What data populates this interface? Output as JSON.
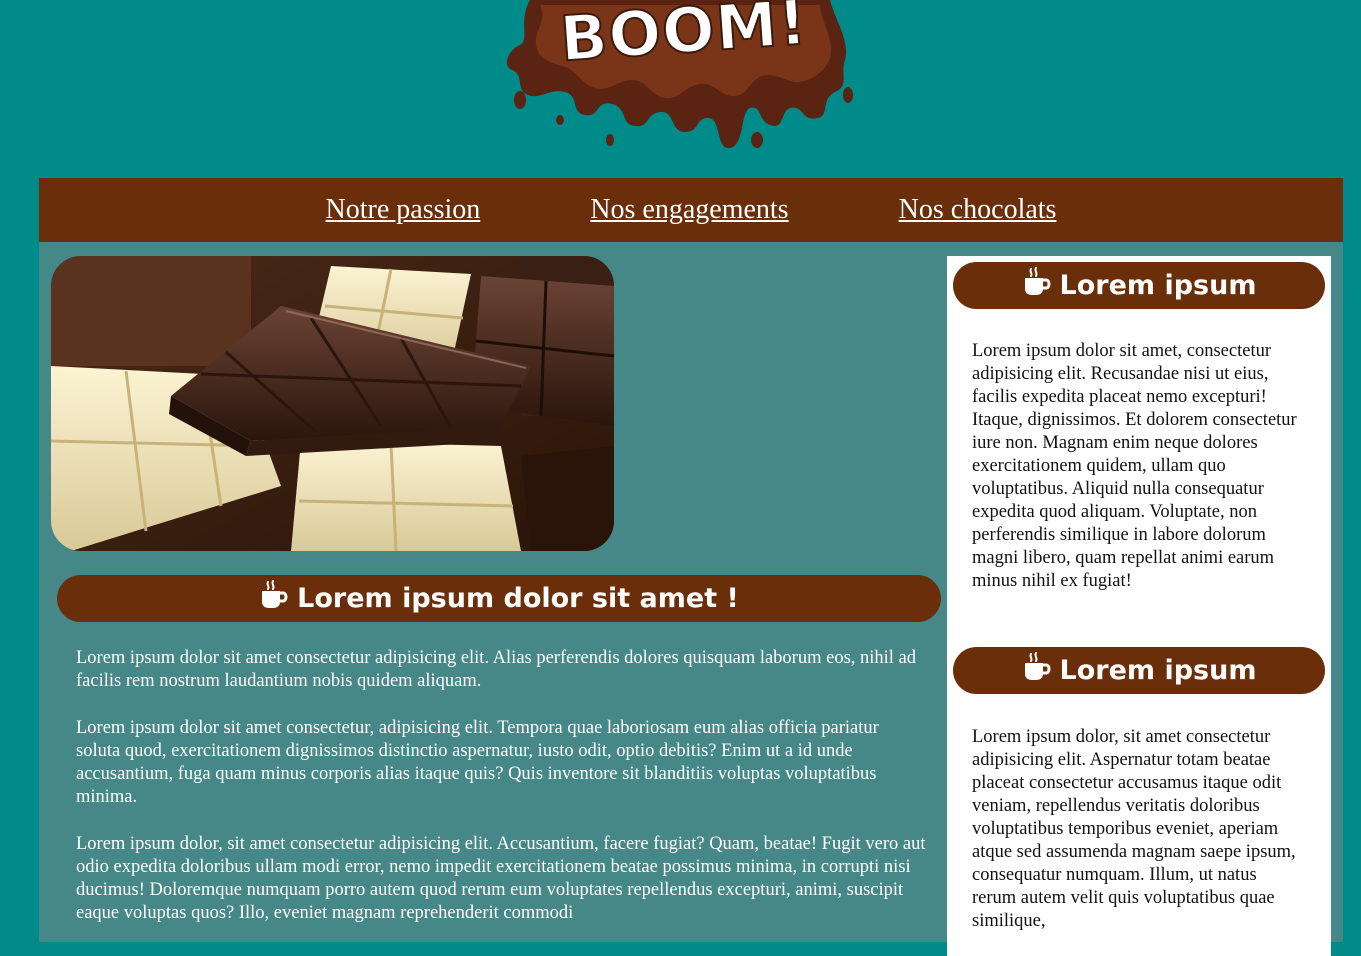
{
  "logo": {
    "text": "BOOM!"
  },
  "nav": {
    "items": [
      {
        "label": "Notre passion"
      },
      {
        "label": "Nos engagements"
      },
      {
        "label": "Nos chocolats"
      }
    ]
  },
  "main": {
    "title": "Lorem ipsum dolor sit amet !",
    "paragraphs": [
      "Lorem ipsum dolor sit amet consectetur adipisicing elit. Alias perferendis dolores quisquam laborum eos, nihil ad facilis rem nostrum laudantium nobis quidem aliquam.",
      "Lorem ipsum dolor sit amet consectetur, adipisicing elit. Tempora quae laboriosam eum alias officia pariatur soluta quod, exercitationem dignissimos distinctio aspernatur, iusto odit, optio debitis? Enim ut a id unde accusantium, fuga quam minus corporis alias itaque quis? Quis inventore sit blanditiis voluptas voluptatibus minima.",
      "Lorem ipsum dolor, sit amet consectetur adipisicing elit. Accusantium, facere fugiat? Quam, beatae! Fugit vero aut odio expedita doloribus ullam modi error, nemo impedit exercitationem beatae possimus minima, in corrupti nisi ducimus! Doloremque numquam porro autem quod rerum eum voluptates repellendus excepturi, animi, suscipit eaque voluptas quos? Illo, eveniet magnam reprehenderit commodi"
    ]
  },
  "aside": {
    "sections": [
      {
        "title": "Lorem ipsum",
        "text": "Lorem ipsum dolor sit amet, consectetur adipisicing elit. Recusandae nisi ut eius, facilis expedita placeat nemo excepturi! Itaque, dignissimos. Et dolorem consectetur iure non. Magnam enim neque dolores exercitationem quidem, ullam quo voluptatibus. Aliquid nulla consequatur expedita quod aliquam. Voluptate, non perferendis similique in labore dolorum magni libero, quam repellat animi earum minus nihil ex fugiat!"
      },
      {
        "title": "Lorem ipsum",
        "text": "Lorem ipsum dolor, sit amet consectetur adipisicing elit. Aspernatur totam beatae placeat consectetur accusamus itaque odit veniam, repellendus veritatis doloribus voluptatibus temporibus eveniet, aperiam atque sed assumenda magnam saepe ipsum, consequatur numquam. Illum, ut natus rerum autem velit quis voluptatibus quae similique,"
      }
    ]
  },
  "colors": {
    "page_background": "#008b8b",
    "content_background": "#468787",
    "brand_brown": "#6b2e0a",
    "aside_background": "#ffffff"
  },
  "icons": {
    "heading_icon": "coffee-cup-icon"
  }
}
